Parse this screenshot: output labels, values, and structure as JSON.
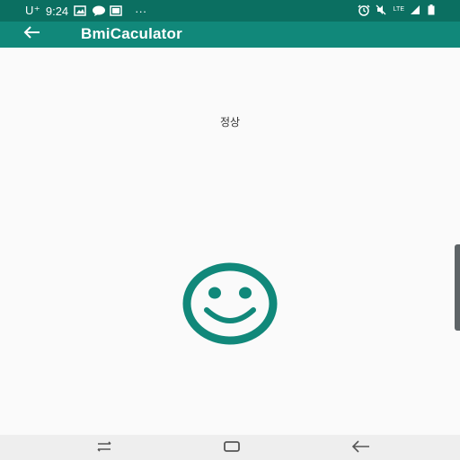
{
  "status_bar": {
    "carrier": "U⁺",
    "time": "9:24",
    "more": "···",
    "lte_label": "LTE",
    "color": "#0b6f61"
  },
  "app_bar": {
    "title": "BmiCaculator",
    "color": "#11887a"
  },
  "main": {
    "result_text": "정상",
    "result_icon": "smiley-face-icon",
    "icon_color": "#11887a"
  },
  "nav_bar": {
    "buttons": [
      "recent-apps",
      "home",
      "back"
    ]
  }
}
